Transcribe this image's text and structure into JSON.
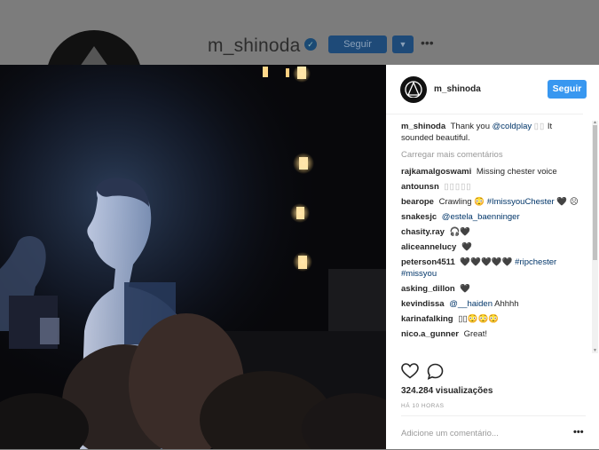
{
  "profile": {
    "username": "m_shinoda",
    "follow_label": "Seguir",
    "dropdown_icon": "chevron-down-icon",
    "more_icon": "more-horizontal-icon"
  },
  "post": {
    "username": "m_shinoda",
    "follow_label": "Seguir",
    "caption": {
      "user": "m_shinoda",
      "text": "Thank you",
      "mention": "@coldplay",
      "glyphs": "▯▯",
      "text_after": "It sounded beautiful."
    },
    "load_more": "Carregar mais comentários",
    "comments": [
      {
        "user": "rajkamalgoswami",
        "text": "Missing chester voice"
      },
      {
        "user": "antounsn",
        "text": "▯▯▯▯▯"
      },
      {
        "user": "bearope",
        "text": "Crawling 😳",
        "tag": "#ImissyouChester",
        "after": "🖤 ☹"
      },
      {
        "user": "snakesjc",
        "tag": "@estela_baenninger"
      },
      {
        "user": "chasity.ray",
        "text": "🎧🖤"
      },
      {
        "user": "aliceannelucy",
        "text": "🖤"
      },
      {
        "user": "peterson4511",
        "text": "🖤🖤🖤🖤🖤",
        "tag": "#ripchester #missyou"
      },
      {
        "user": "asking_dillon",
        "text": "🖤"
      },
      {
        "user": "kevindissa",
        "tag": "@__haiden",
        "after": "Ahhhh"
      },
      {
        "user": "karinafalking",
        "text": "▯▯😳😳😳"
      },
      {
        "user": "nico.a_gunner",
        "text": "Great!"
      }
    ],
    "views": "324.284 visualizações",
    "time": "HÁ 10 HORAS",
    "comment_placeholder": "Adicione um comentário...",
    "comment_more": "•••"
  },
  "colors": {
    "accent": "#3897f0",
    "mention": "#003569"
  }
}
